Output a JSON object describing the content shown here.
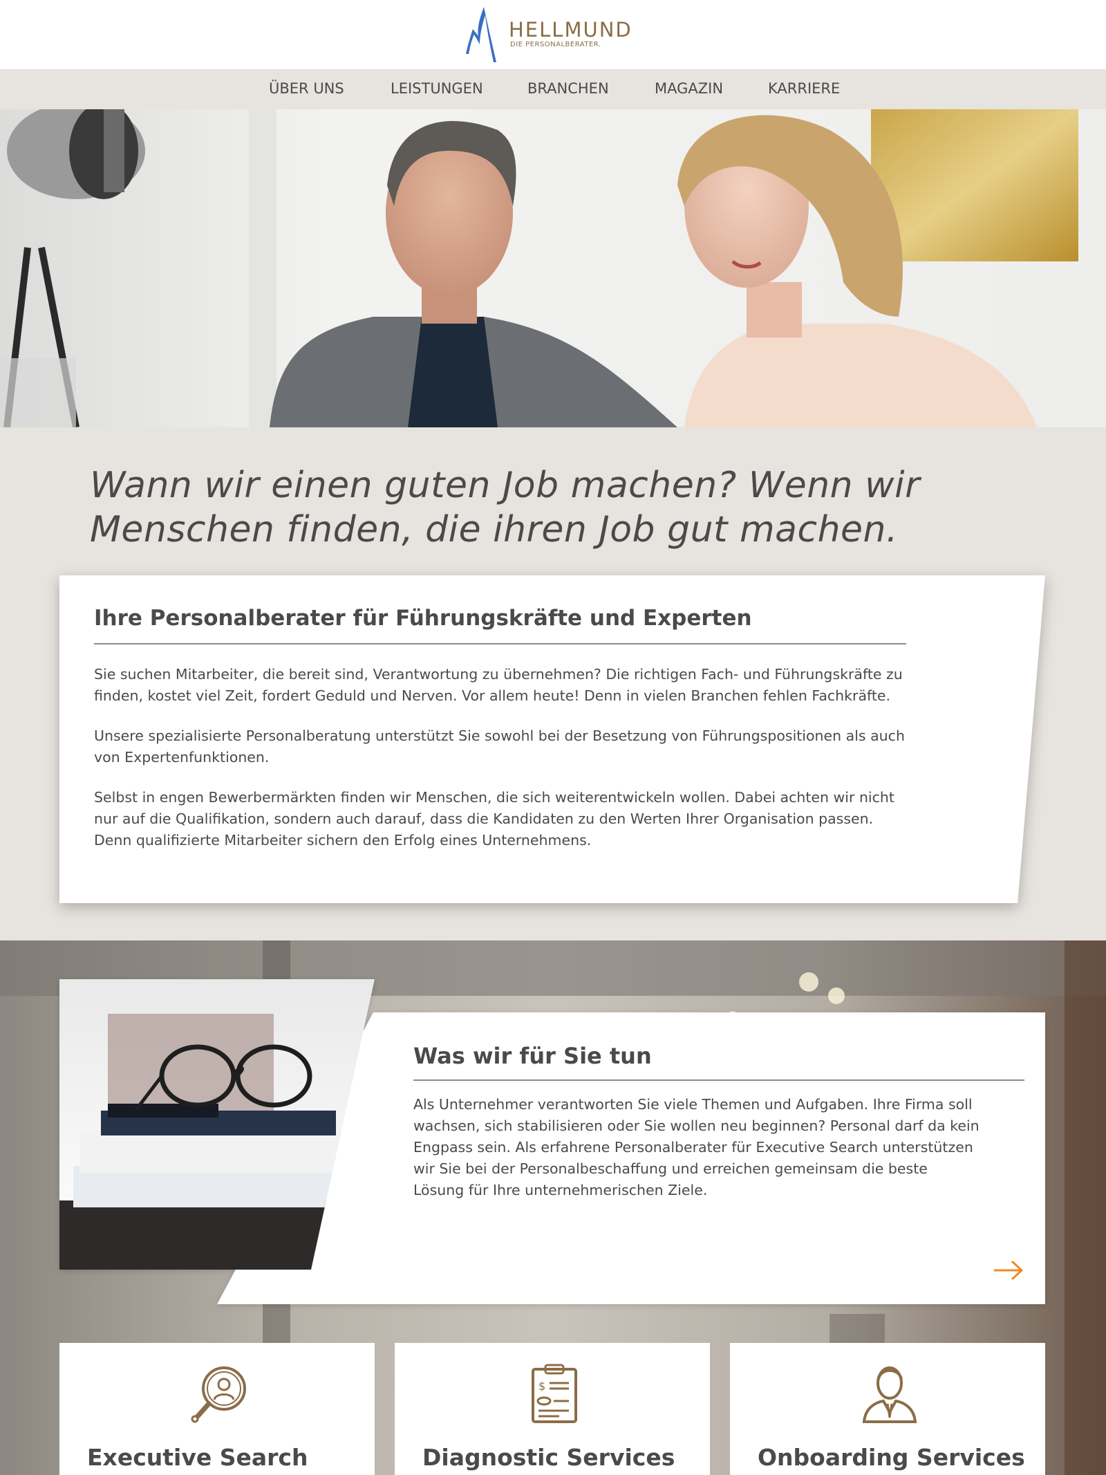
{
  "brand": {
    "name": "HELLMUND",
    "tagline": "DIE PERSONALBERATER.",
    "color": "#8a6d46",
    "mark_color": "#3a6fc4"
  },
  "nav": {
    "items": [
      {
        "label": "ÜBER UNS"
      },
      {
        "label": "LEISTUNGEN"
      },
      {
        "label": "BRANCHEN"
      },
      {
        "label": "MAGAZIN"
      },
      {
        "label": "KARRIERE"
      }
    ]
  },
  "hero": {
    "image": "photo of a man in a grey blazer and a blonde woman looking down at work"
  },
  "intro": {
    "headline": "Wann wir einen guten Job machen? Wenn wir Menschen finden, die ihren Job gut machen.",
    "card_title": "Ihre Personalberater für Führungskräfte und Experten",
    "paragraphs": [
      "Sie suchen Mitarbeiter, die bereit sind, Verantwortung zu übernehmen? Die richtigen Fach- und Führungskräfte zu finden, kostet viel Zeit, fordert Geduld und Nerven. Vor allem heute! Denn in vielen Branchen fehlen Fachkräfte.",
      "Unsere spezialisierte Personalberatung unterstützt Sie sowohl bei der Besetzung von Führungspositionen als auch von Expertenfunktionen.",
      "Selbst in engen Bewerbermärkten finden wir Menschen, die sich weiterentwickeln wollen. Dabei achten wir nicht nur auf die Qualifikation, sondern auch darauf, dass die Kandidaten zu den Werten Ihrer Organisation passen. Denn qualifizierte Mitarbeiter sichern den Erfolg eines Unternehmens."
    ]
  },
  "what_we_do": {
    "title": "Was wir für Sie tun",
    "text": "Als Unternehmer verantworten Sie viele Themen und Aufgaben. Ihre Firma soll wachsen, sich stabilisieren oder Sie wollen neu beginnen? Personal darf da kein Engpass sein. Als erfahrene Personalberater für Executive Search unterstützen wir Sie bei der Personalbeschaffung und erreichen gemeinsam die beste Lösung für Ihre unternehmerischen Ziele.",
    "arrow_icon": "arrow-right-icon",
    "accent_color": "#f08a24"
  },
  "services": [
    {
      "title": "Executive Search",
      "icon": "magnifier-person-icon"
    },
    {
      "title": "Diagnostic Services",
      "icon": "clipboard-icon"
    },
    {
      "title": "Onboarding Services",
      "icon": "person-suit-icon"
    }
  ],
  "colors": {
    "background": "#e7e3de",
    "text": "#4a4a4a",
    "icon": "#8a6d46"
  }
}
